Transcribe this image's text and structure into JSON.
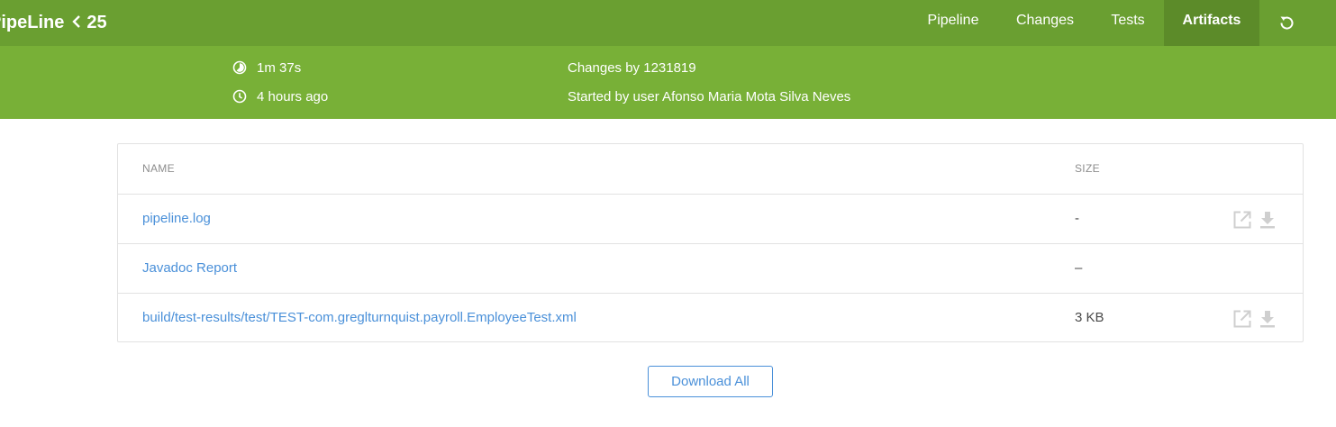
{
  "header": {
    "title": "PipeLine",
    "run_number": "25",
    "tabs": [
      {
        "label": "Pipeline",
        "active": false
      },
      {
        "label": "Changes",
        "active": false
      },
      {
        "label": "Tests",
        "active": false
      },
      {
        "label": "Artifacts",
        "active": true
      }
    ],
    "replay_icon": "replay-icon"
  },
  "summary": {
    "duration": "1m 37s",
    "time_ago": "4 hours ago",
    "changes": "Changes by 1231819",
    "started_by": "Started by user Afonso Maria Mota Silva Neves"
  },
  "artifacts": {
    "columns": {
      "name": "NAME",
      "size": "SIZE"
    },
    "rows": [
      {
        "name": "pipeline.log",
        "size": "-",
        "has_actions": true
      },
      {
        "name": "Javadoc Report",
        "size": "–",
        "has_actions": false
      },
      {
        "name": "build/test-results/test/TEST-com.greglturnquist.payroll.EmployeeTest.xml",
        "size": "3 KB",
        "has_actions": true
      }
    ],
    "download_all_label": "Download All"
  },
  "colors": {
    "topbar": "#6a9f31",
    "topbar_active": "#5c8b29",
    "subbar": "#78b037",
    "link": "#4a90d9"
  }
}
